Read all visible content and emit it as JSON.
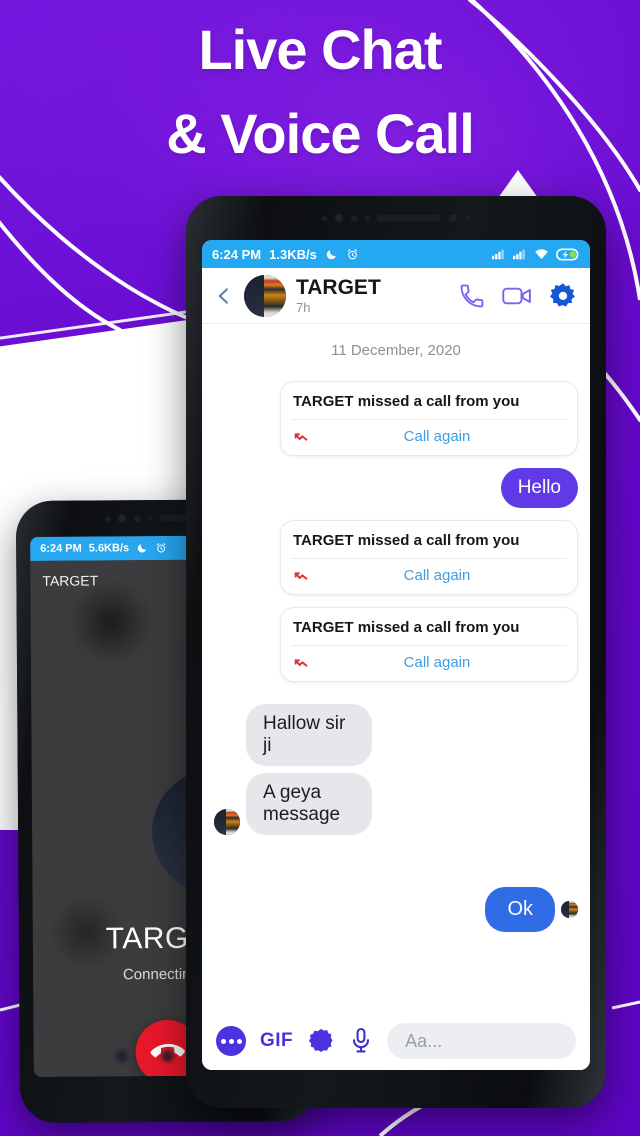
{
  "promo": {
    "headline_line1": "Live Chat",
    "headline_line2": "& Voice Call",
    "background_color": "#6a0dd4",
    "accent_purple": "#5f3ae6",
    "accent_blue": "#2f6ce5",
    "status_bar_blue": "#24a8f2"
  },
  "chat_phone": {
    "status_bar": {
      "time": "6:24 PM",
      "data_rate": "1.3KB/s",
      "icons": [
        "moon-icon",
        "alarm-icon",
        "signal-icon",
        "signal-icon",
        "wifi-icon",
        "battery-charging-icon"
      ]
    },
    "header": {
      "back_icon": "chevron-left-icon",
      "avatar": "contact-avatar",
      "title": "TARGET",
      "subtitle": "7h",
      "actions": [
        "phone-call-icon",
        "video-call-icon",
        "settings-gear-icon"
      ]
    },
    "date_separator": "11 December, 2020",
    "messages": [
      {
        "kind": "missed-call",
        "text": "TARGET missed a call from you",
        "action": "Call again",
        "icon": "missed-call-arrow-icon"
      },
      {
        "kind": "outgoing-purple",
        "text": "Hello"
      },
      {
        "kind": "missed-call",
        "text": "TARGET missed a call from you",
        "action": "Call again",
        "icon": "missed-call-arrow-icon"
      },
      {
        "kind": "missed-call",
        "text": "TARGET missed a call from you",
        "action": "Call again",
        "icon": "missed-call-arrow-icon"
      },
      {
        "kind": "incoming-grey",
        "text": "Hallow sir ji"
      },
      {
        "kind": "incoming-grey",
        "text": "A geya message"
      },
      {
        "kind": "outgoing-blue",
        "text": "Ok"
      }
    ],
    "input_bar": {
      "more_icon": "more-dots-icon",
      "gif_label": "GIF",
      "sticker_icon": "sticker-badge-icon",
      "mic_icon": "microphone-icon",
      "input_placeholder": "Aa..."
    }
  },
  "call_phone": {
    "status_bar": {
      "time": "6:24 PM",
      "data_rate": "5.6KB/s",
      "icons": [
        "moon-icon",
        "alarm-icon"
      ]
    },
    "screen_label": "TARGET",
    "caller_name": "TARGET",
    "call_status": "Connecting...",
    "end_call_icon": "end-call-icon",
    "end_call_color": "#e8182b"
  }
}
